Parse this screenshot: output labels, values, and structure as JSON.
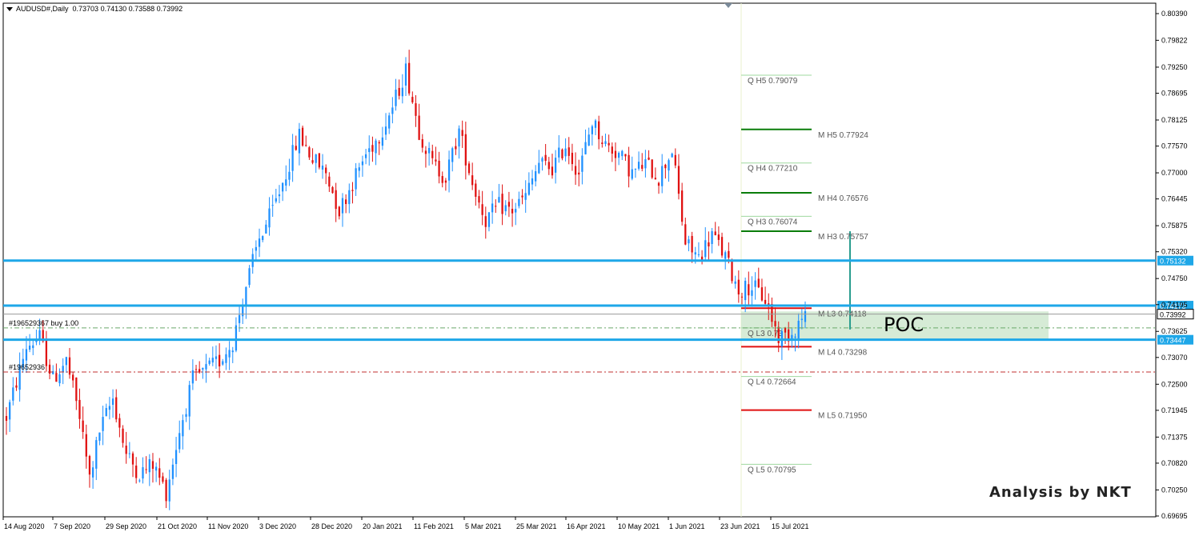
{
  "header": {
    "symbol": "AUDUSD#,Daily",
    "ohlc": "0.73703 0.74130 0.73588 0.73992"
  },
  "credit": "Analysis by NKT",
  "colors": {
    "bull": "#1e90ff",
    "bear": "#e01010",
    "hline": "#1ea7e8",
    "poc_zone": "#cfe8cf",
    "m_high": "#0a7d0a",
    "m_low": "#e01010",
    "q_level": "#9fd89f"
  },
  "chart_data": {
    "type": "candlestick",
    "symbol": "AUDUSD#",
    "timeframe": "Daily",
    "ylim": [
      0.6965,
      0.8045
    ],
    "y_ticks": [
      "0.80390",
      "0.79822",
      "0.79250",
      "0.78695",
      "0.78125",
      "0.77570",
      "0.77000",
      "0.76445",
      "0.75875",
      "0.75320",
      "0.74750",
      "0.74195",
      "0.73625",
      "0.73070",
      "0.72500",
      "0.71945",
      "0.71375",
      "0.70820",
      "0.70250",
      "0.69695"
    ],
    "x_ticks": [
      "14 Aug 2020",
      "7 Sep 2020",
      "29 Sep 2020",
      "21 Oct 2020",
      "11 Nov 2020",
      "3 Dec 2020",
      "28 Dec 2020",
      "20 Jan 2021",
      "11 Feb 2021",
      "5 Mar 2021",
      "25 Mar 2021",
      "16 Apr 2021",
      "10 May 2021",
      "1 Jun 2021",
      "23 Jun 2021",
      "15 Jul 2021"
    ],
    "price_path": [
      [
        0,
        0.718
      ],
      [
        6,
        0.733
      ],
      [
        10,
        0.735
      ],
      [
        14,
        0.726
      ],
      [
        18,
        0.73
      ],
      [
        22,
        0.718
      ],
      [
        25,
        0.705
      ],
      [
        28,
        0.715
      ],
      [
        32,
        0.722
      ],
      [
        36,
        0.71
      ],
      [
        40,
        0.706
      ],
      [
        44,
        0.708
      ],
      [
        48,
        0.702
      ],
      [
        52,
        0.715
      ],
      [
        56,
        0.726
      ],
      [
        60,
        0.728
      ],
      [
        64,
        0.73
      ],
      [
        68,
        0.734
      ],
      [
        72,
        0.746
      ],
      [
        76,
        0.756
      ],
      [
        80,
        0.762
      ],
      [
        84,
        0.77
      ],
      [
        88,
        0.778
      ],
      [
        92,
        0.773
      ],
      [
        96,
        0.77
      ],
      [
        100,
        0.762
      ],
      [
        104,
        0.768
      ],
      [
        108,
        0.774
      ],
      [
        112,
        0.778
      ],
      [
        116,
        0.784
      ],
      [
        120,
        0.792
      ],
      [
        124,
        0.779
      ],
      [
        128,
        0.772
      ],
      [
        132,
        0.769
      ],
      [
        136,
        0.779
      ],
      [
        140,
        0.768
      ],
      [
        144,
        0.76
      ],
      [
        148,
        0.763
      ],
      [
        152,
        0.762
      ],
      [
        156,
        0.765
      ],
      [
        160,
        0.772
      ],
      [
        164,
        0.771
      ],
      [
        168,
        0.776
      ],
      [
        172,
        0.77
      ],
      [
        176,
        0.781
      ],
      [
        180,
        0.776
      ],
      [
        184,
        0.774
      ],
      [
        188,
        0.77
      ],
      [
        192,
        0.772
      ],
      [
        196,
        0.769
      ],
      [
        200,
        0.775
      ],
      [
        204,
        0.755
      ],
      [
        208,
        0.752
      ],
      [
        212,
        0.757
      ],
      [
        216,
        0.752
      ],
      [
        220,
        0.745
      ],
      [
        224,
        0.746
      ],
      [
        228,
        0.743
      ],
      [
        232,
        0.735
      ],
      [
        236,
        0.736
      ],
      [
        240,
        0.74
      ]
    ],
    "candle_count": 241,
    "horizontal_levels": [
      {
        "price": 0.75132,
        "label": "0.75132"
      },
      {
        "price": 0.74173,
        "label": "0.74173"
      },
      {
        "price": 0.73447,
        "label": "0.73447"
      }
    ],
    "current_price": {
      "price": 0.73992,
      "label": "0.73992"
    },
    "pivot_levels": [
      {
        "label": "Q  H5 0.79079",
        "price": 0.79079,
        "kind": "Q"
      },
      {
        "label": "M  H5 0.77924",
        "price": 0.77924,
        "kind": "MH"
      },
      {
        "label": "Q  H4 0.77210",
        "price": 0.7721,
        "kind": "Q"
      },
      {
        "label": "M  H4 0.76576",
        "price": 0.76576,
        "kind": "MH"
      },
      {
        "label": "Q  H3 0.76074",
        "price": 0.76074,
        "kind": "Q"
      },
      {
        "label": "M  H3 0.75757",
        "price": 0.75757,
        "kind": "MH"
      },
      {
        "label": "M  L3 0.74118",
        "price": 0.74118,
        "kind": "ML"
      },
      {
        "label": "Q  L3 0.73",
        "price": 0.737,
        "kind": "Q"
      },
      {
        "label": "M  L4 0.73298",
        "price": 0.73298,
        "kind": "ML"
      },
      {
        "label": "Q  L4 0.72664",
        "price": 0.72664,
        "kind": "Q"
      },
      {
        "label": "M  L5 0.71950",
        "price": 0.7195,
        "kind": "ML"
      },
      {
        "label": "Q  L5 0.70795",
        "price": 0.70795,
        "kind": "Q"
      }
    ],
    "orders": [
      {
        "label": "#196529367 buy 1.00",
        "price": 0.737
      },
      {
        "label": "#19652936",
        "price": 0.7276
      }
    ],
    "poc": {
      "label": "POC",
      "top": 0.7405,
      "bottom": 0.73447
    }
  }
}
